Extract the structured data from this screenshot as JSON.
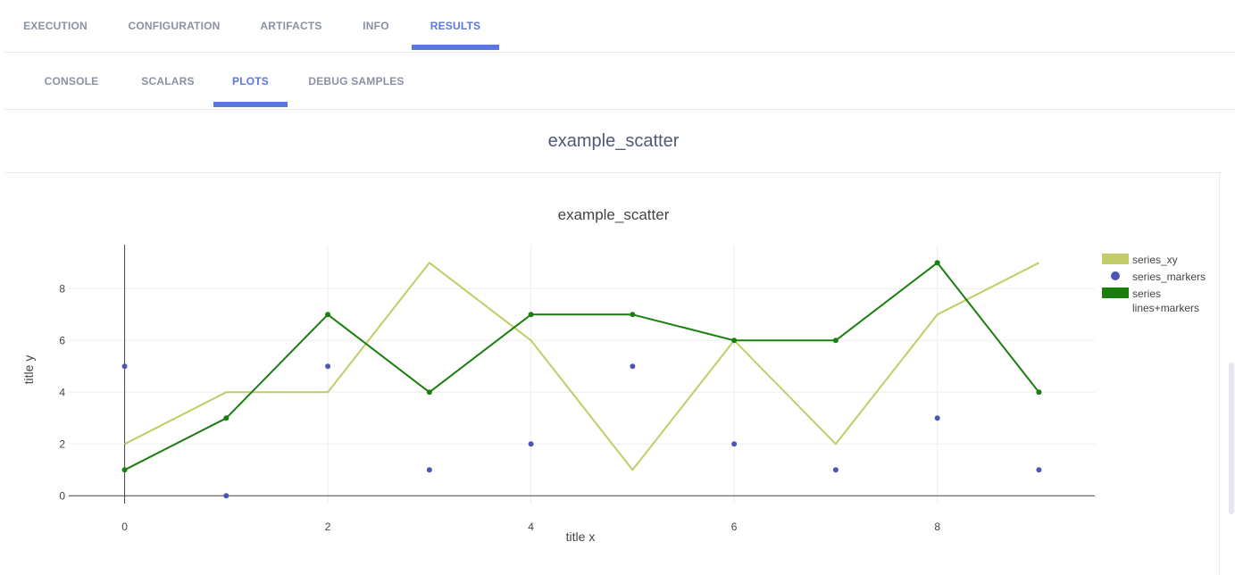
{
  "main_tabs": [
    {
      "label": "EXECUTION",
      "active": false
    },
    {
      "label": "CONFIGURATION",
      "active": false
    },
    {
      "label": "ARTIFACTS",
      "active": false
    },
    {
      "label": "INFO",
      "active": false
    },
    {
      "label": "RESULTS",
      "active": true
    }
  ],
  "sub_tabs": [
    {
      "label": "CONSOLE",
      "active": false
    },
    {
      "label": "SCALARS",
      "active": false
    },
    {
      "label": "PLOTS",
      "active": true
    },
    {
      "label": "DEBUG SAMPLES",
      "active": false
    }
  ],
  "plot_header": {
    "title": "example_scatter"
  },
  "colors": {
    "accent": "#5a76e6",
    "tab_inactive": "#8a91a5",
    "series_xy": "#c2cc68",
    "series_markers": "#4b57b5",
    "series_lines_markers": "#1a7f0e"
  },
  "chart_data": {
    "type": "scatter",
    "title": "example_scatter",
    "xlabel": "title x",
    "ylabel": "title y",
    "xlim": [
      -0.55,
      9.55
    ],
    "ylim": [
      -0.3,
      9.7
    ],
    "x_ticks": [
      0,
      2,
      4,
      6,
      8
    ],
    "y_ticks": [
      0,
      2,
      4,
      6,
      8
    ],
    "grid": true,
    "legend_position": "top-right",
    "x": [
      0,
      1,
      2,
      3,
      4,
      5,
      6,
      7,
      8,
      9
    ],
    "series": [
      {
        "name": "series_xy",
        "mode": "lines",
        "color": "#c2cc68",
        "values": [
          2,
          4,
          4,
          9,
          6,
          1,
          6,
          2,
          7,
          9
        ]
      },
      {
        "name": "series_markers",
        "mode": "markers",
        "color": "#4b57b5",
        "values": [
          5,
          0,
          5,
          1,
          2,
          5,
          2,
          1,
          3,
          1
        ]
      },
      {
        "name": "series lines+markers",
        "legend_lines": [
          "series",
          "lines+markers"
        ],
        "mode": "lines+markers",
        "color": "#1a7f0e",
        "values": [
          1,
          3,
          7,
          4,
          7,
          7,
          6,
          6,
          9,
          4
        ]
      }
    ]
  }
}
